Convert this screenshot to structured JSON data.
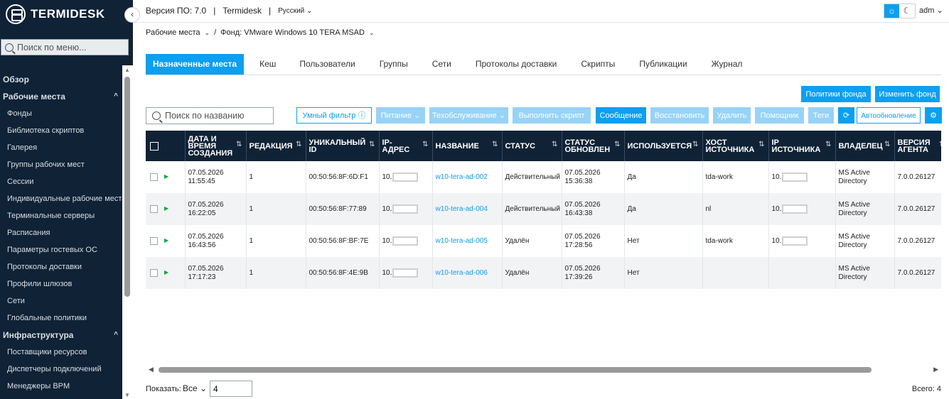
{
  "app": {
    "logo_text": "TERMIDESK",
    "collapse_glyph": "‹"
  },
  "topbar": {
    "version": "Версия ПО: 7.0",
    "separator": "|",
    "product": "Termidesk",
    "language": "Русский",
    "user": "adm",
    "sun_icon": "☼",
    "moon_icon": "☾"
  },
  "sidebar": {
    "search_placeholder": "Поиск по меню...",
    "sections": [
      {
        "label": "Обзор",
        "items": []
      },
      {
        "label": "Рабочие места",
        "items": [
          "Фонды",
          "Библиотека скриптов",
          "Галерея",
          "Группы рабочих мест",
          "Сессии",
          "Индивидуальные рабочие места",
          "Терминальные серверы",
          "Расписания",
          "Параметры гостевых ОС",
          "Протоколы доставки",
          "Профили шлюзов",
          "Сети",
          "Глобальные политики"
        ]
      },
      {
        "label": "Инфраструктура",
        "items": [
          "Поставщики ресурсов",
          "Диспетчеры подключений",
          "Менеджеры BPM"
        ]
      }
    ]
  },
  "breadcrumb": {
    "first": "Рабочие места",
    "sep": "/",
    "second": "Фонд: VMware Windows 10 TERA MSAD"
  },
  "tabs": [
    "Назначенные места",
    "Кеш",
    "Пользователи",
    "Группы",
    "Сети",
    "Протоколы доставки",
    "Скрипты",
    "Публикации",
    "Журнал"
  ],
  "actions": {
    "pool_policies": "Политики фонда",
    "edit_pool": "Изменить фонд",
    "search_placeholder": "Поиск по названию",
    "smart_filter": "Умный фильтр",
    "power": "Питание",
    "maintenance": "Техобслуживание",
    "run_script": "Выполнить скрипт",
    "message": "Сообщение",
    "restore": "Восстановить",
    "delete": "Удалить",
    "assistant": "Помощник",
    "tags": "Теги",
    "auto_refresh": "Автообновление"
  },
  "table": {
    "columns": [
      "ДАТА И ВРЕМЯ СОЗДАНИЯ",
      "РЕДАКЦИЯ",
      "УНИКАЛЬНЫЙ ID",
      "IP-АДРЕС",
      "НАЗВАНИЕ",
      "СТАТУС",
      "СТАТУС ОБНОВЛЕН",
      "ИСПОЛЬЗУЕТСЯ",
      "ХОСТ ИСТОЧНИКА",
      "IP ИСТОЧНИКА",
      "ВЛАДЕЛЕЦ",
      "ВЕРСИЯ АГЕНТА"
    ],
    "rows": [
      {
        "created": "07.05.2026 11:55:45",
        "revision": "1",
        "uid": "00:50:56:8F:6D:F1",
        "ip": "10.",
        "name": "w10-tera-ad-002",
        "status": "Действительный",
        "updated": "07.05.2026 15:36:38",
        "in_use": "Да",
        "src_host": "tda-work",
        "src_ip": "10.",
        "owner": "MS Active Directory",
        "agent": "7.0.0.26127"
      },
      {
        "created": "07.05.2026 16:22:05",
        "revision": "1",
        "uid": "00:50:56:8F:77:89",
        "ip": "10.",
        "name": "w10-tera-ad-004",
        "status": "Действительный",
        "updated": "07.05.2026 16:43:38",
        "in_use": "Да",
        "src_host": "nl",
        "src_ip": "10.",
        "owner": "MS Active Directory",
        "agent": "7.0.0.26127"
      },
      {
        "created": "07.05.2026 16:43:56",
        "revision": "1",
        "uid": "00:50:56:8F:BF:7E",
        "ip": "10.",
        "name": "w10-tera-ad-005",
        "status": "Удалён",
        "updated": "07.05.2026 17:28:56",
        "in_use": "Нет",
        "src_host": "tda-work",
        "src_ip": "10.",
        "owner": "MS Active Directory",
        "agent": "7.0.0.26127"
      },
      {
        "created": "07.05.2026 17:17:23",
        "revision": "1",
        "uid": "00:50:56:8F:4E:9B",
        "ip": "10.",
        "name": "w10-tera-ad-006",
        "status": "Удалён",
        "updated": "07.05.2026 17:39:26",
        "in_use": "Нет",
        "src_host": "",
        "src_ip": "",
        "owner": "MS Active Directory",
        "agent": "7.0.0.26127"
      }
    ]
  },
  "footer": {
    "show_label": "Показать:",
    "show_value": "Все",
    "page_size": "4",
    "total": "Всего: 4"
  },
  "colors": {
    "accent": "#0d9ff0",
    "sidebar_bg": "#0f2236",
    "status_ok": "#16a34a"
  }
}
